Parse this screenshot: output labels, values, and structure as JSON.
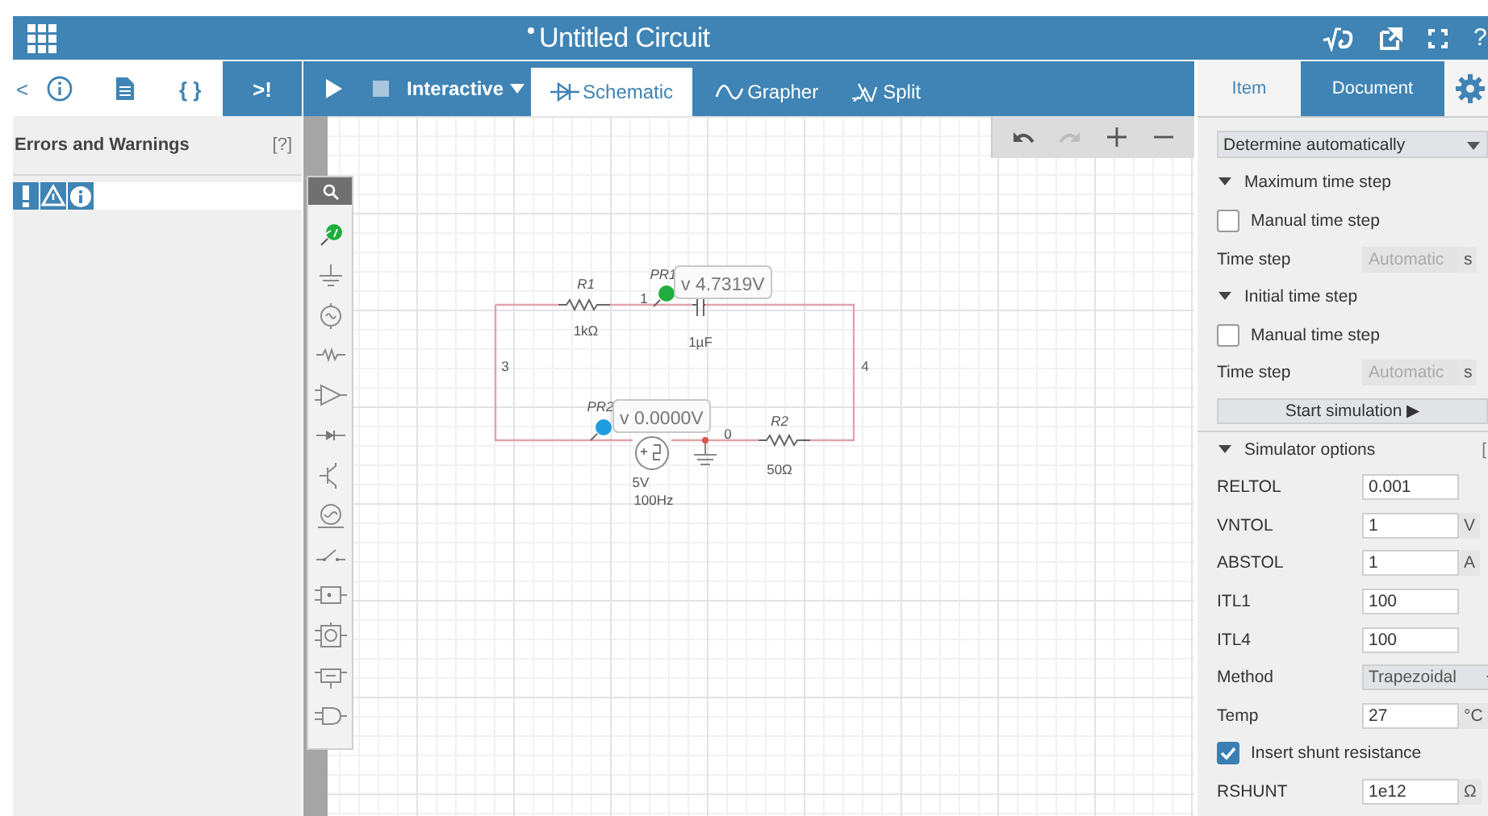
{
  "header": {
    "title": "Untitled Circuit",
    "modified": true,
    "help": "?"
  },
  "left_panel": {
    "scroll": "<",
    "tabs": [
      {
        "kind": "info",
        "selected": false
      },
      {
        "kind": "document",
        "selected": false
      },
      {
        "kind": "text",
        "label": "{ }",
        "selected": false
      },
      {
        "kind": "text",
        "label": ">!",
        "selected": true
      }
    ],
    "title": "Errors and Warnings",
    "help": "[?]",
    "filters": [
      {
        "kind": "error",
        "selected": true
      },
      {
        "kind": "warning",
        "selected": true
      },
      {
        "kind": "info",
        "selected": true
      }
    ]
  },
  "toolbar": {
    "mode": "Interactive",
    "views": [
      {
        "kind": "schematic",
        "label": "Schematic",
        "selected": true
      },
      {
        "kind": "grapher",
        "label": "Grapher",
        "selected": false
      },
      {
        "kind": "split",
        "label": "Split",
        "selected": false
      }
    ]
  },
  "canvas_tools": [
    {
      "kind": "undo",
      "disabled": false
    },
    {
      "kind": "redo",
      "disabled": true
    },
    {
      "kind": "zoom-in",
      "disabled": false
    },
    {
      "kind": "zoom-out",
      "disabled": false
    }
  ],
  "circuit": {
    "components": [
      {
        "kind": "resistor",
        "name": "R1",
        "value": "1kΩ"
      },
      {
        "kind": "capacitor",
        "value": "1µF"
      },
      {
        "kind": "source",
        "value": "5V",
        "frequency": "100Hz"
      },
      {
        "kind": "ground"
      },
      {
        "kind": "resistor",
        "name": "R2",
        "value": "50Ω"
      }
    ],
    "nodes": [
      "1",
      "3",
      "4",
      "0"
    ],
    "probes": [
      {
        "name": "PR1",
        "reading": "v 4.7319V",
        "color": "#1fae3e"
      },
      {
        "name": "PR2",
        "reading": "v 0.0000V",
        "color": "#1e9ee0"
      }
    ]
  },
  "properties": {
    "tabs": [
      {
        "kind": "text",
        "label": "Item",
        "selected": false
      },
      {
        "kind": "text",
        "label": "Document",
        "selected": true
      },
      {
        "kind": "gear",
        "selected": false
      }
    ],
    "rows": [
      {
        "kind": "select",
        "value": "Determine automatically"
      },
      {
        "kind": "section",
        "label": "Maximum time step",
        "expanded": true
      },
      {
        "kind": "checkbox",
        "label": "Manual time step",
        "checked": false
      },
      {
        "kind": "field",
        "label": "Time step",
        "placeholder": "Automatic",
        "unit": "s",
        "disabled": true
      },
      {
        "kind": "section",
        "label": "Initial time step",
        "expanded": true
      },
      {
        "kind": "checkbox",
        "label": "Manual time step",
        "checked": false
      },
      {
        "kind": "field",
        "label": "Time step",
        "placeholder": "Automatic",
        "unit": "s",
        "disabled": true
      },
      {
        "kind": "button",
        "label": "Start simulation ▶"
      },
      {
        "kind": "section",
        "label": "Simulator options",
        "expanded": true,
        "help": "["
      },
      {
        "kind": "field",
        "label": "RELTOL",
        "value": "0.001",
        "disabled": false
      },
      {
        "kind": "field",
        "label": "VNTOL",
        "value": "1",
        "unit": "V",
        "disabled": false
      },
      {
        "kind": "field",
        "label": "ABSTOL",
        "value": "1",
        "unit": "A",
        "disabled": false
      },
      {
        "kind": "field",
        "label": "ITL1",
        "value": "100",
        "disabled": false
      },
      {
        "kind": "field",
        "label": "ITL4",
        "value": "100",
        "disabled": false
      },
      {
        "kind": "dropdown",
        "label": "Method",
        "value": "Trapezoidal"
      },
      {
        "kind": "field",
        "label": "Temp",
        "value": "27",
        "unit": "°C",
        "disabled": false
      },
      {
        "kind": "checkbox",
        "label": "Insert shunt resistance",
        "checked": true
      },
      {
        "kind": "field",
        "label": "RSHUNT",
        "value": "1e12",
        "unit": "Ω",
        "disabled": false
      }
    ]
  }
}
